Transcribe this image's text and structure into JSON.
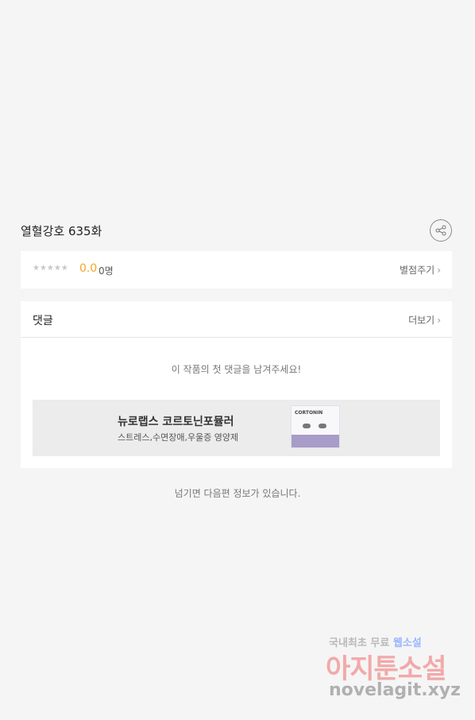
{
  "episode": {
    "title": "열혈강호 635화"
  },
  "rating": {
    "stars": "★★★★★",
    "score": "0.0",
    "count": "0명",
    "rate_label": "별점주기",
    "chevron": "›"
  },
  "comments": {
    "title": "댓글",
    "more_label": "더보기",
    "chevron": "›",
    "empty_message": "이 작품의 첫 댓글을 남겨주세요!"
  },
  "ad": {
    "title": "뉴로랩스 코르토닌포뮬러",
    "subtitle": "스트레스,수면장애,우울증 영양제",
    "product_label": "CORTONIN"
  },
  "footer": {
    "next_info": "넘기면 다음편 정보가 있습니다."
  },
  "watermark": {
    "line1_prefix": "국내최초 무료 ",
    "line1_highlight": "웹소설",
    "line2": "아지툰소설",
    "line3": "novelagit.xyz"
  },
  "icons": {
    "share": "share-icon"
  },
  "colors": {
    "score": "#f5a623",
    "background": "#f5f5f5"
  }
}
